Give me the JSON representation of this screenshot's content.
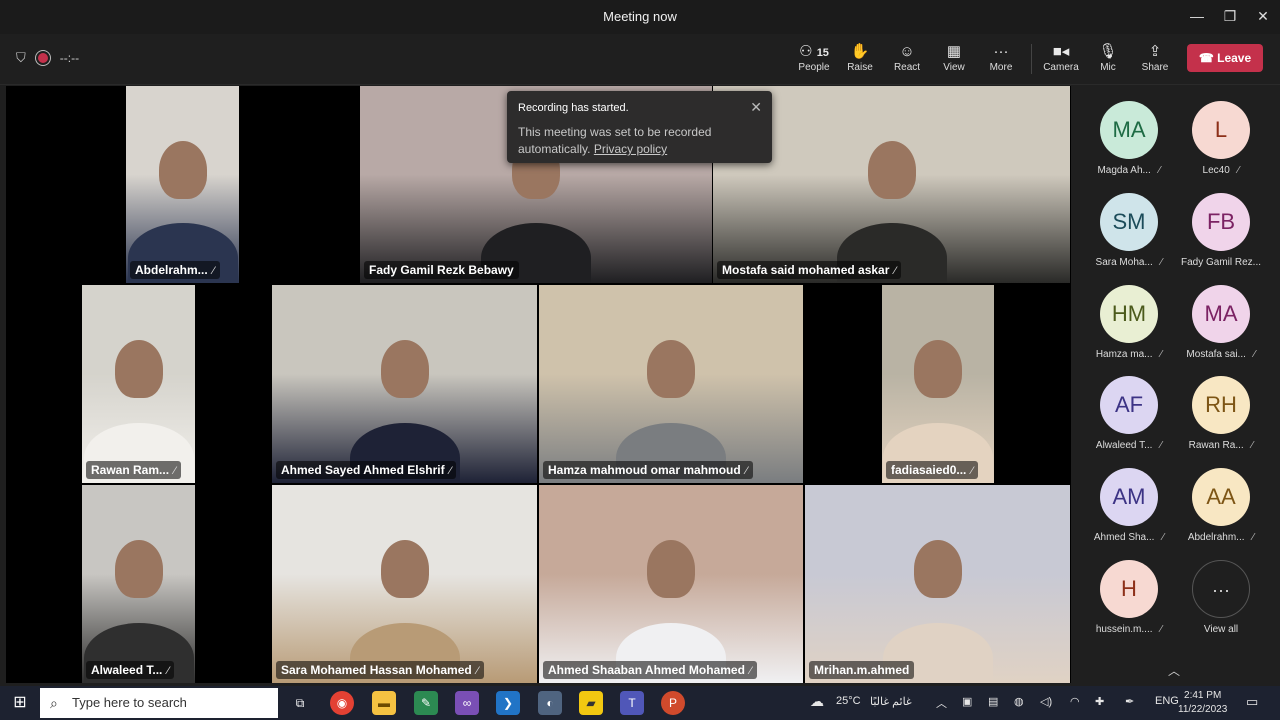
{
  "window": {
    "title": "Meeting now",
    "minimize": "—",
    "restore": "❐",
    "close": "✕"
  },
  "toolbar": {
    "timer": "--:--",
    "people_count": "15",
    "people": "People",
    "raise": "Raise",
    "react": "React",
    "view": "View",
    "more": "More",
    "camera": "Camera",
    "mic": "Mic",
    "share": "Share",
    "leave": "Leave"
  },
  "toast": {
    "title": "Recording has started.",
    "body": "This meeting was set to be recorded automatically.",
    "link": "Privacy policy"
  },
  "tiles": [
    {
      "name": "Abdelrahm...",
      "colors": [
        "#d8d4ce",
        "#2b3550"
      ]
    },
    {
      "name": "Fady Gamil Rezk Bebawy",
      "colors": [
        "#b8a9a6",
        "#1f1f22"
      ]
    },
    {
      "name": "Mostafa said mohamed askar",
      "colors": [
        "#cfc9bd",
        "#2a2a28"
      ]
    },
    {
      "name": "Rawan Ram...",
      "colors": [
        "#d5d3cc",
        "#f2f0ec"
      ]
    },
    {
      "name": "Ahmed Sayed Ahmed Elshrif",
      "colors": [
        "#c9c6be",
        "#1e2236"
      ]
    },
    {
      "name": "Hamza mahmoud omar mahmoud",
      "colors": [
        "#cfc2ab",
        "#7a7d80"
      ]
    },
    {
      "name": "fadiasaied0...",
      "colors": [
        "#b9b3a4",
        "#e4d3c0"
      ]
    },
    {
      "name": "Alwaleed T...",
      "colors": [
        "#c8c6c2",
        "#2f2f2f"
      ]
    },
    {
      "name": "Sara Mohamed Hassan Mohamed",
      "colors": [
        "#e6e4e0",
        "#b89b76"
      ]
    },
    {
      "name": "Ahmed Shaaban Ahmed Mohamed",
      "colors": [
        "#c6a999",
        "#f0f0f2"
      ]
    },
    {
      "name": "Mrihan.m.ahmed",
      "colors": [
        "#c8c9d4",
        "#e0d2c4"
      ]
    }
  ],
  "participants": [
    {
      "initials": "MA",
      "name": "Magda Ah...",
      "bg": "#c9ead9",
      "fg": "#1d6b44"
    },
    {
      "initials": "L",
      "name": "Lec40",
      "bg": "#f7d9d2",
      "fg": "#8d3019"
    },
    {
      "initials": "SM",
      "name": "Sara Moha...",
      "bg": "#cfe4ea",
      "fg": "#1c4c5a"
    },
    {
      "initials": "FB",
      "name": "Fady Gamil Rez...",
      "bg": "#f0d4ea",
      "fg": "#7b2263"
    },
    {
      "initials": "HM",
      "name": "Hamza ma...",
      "bg": "#e9efd3",
      "fg": "#4b5a1b"
    },
    {
      "initials": "MA",
      "name": "Mostafa sai...",
      "bg": "#f0d4ea",
      "fg": "#7b2263"
    },
    {
      "initials": "AF",
      "name": "Alwaleed T...",
      "bg": "#dcd6f2",
      "fg": "#3c3385"
    },
    {
      "initials": "RH",
      "name": "Rawan Ra...",
      "bg": "#f8e7c3",
      "fg": "#7d5515"
    },
    {
      "initials": "AM",
      "name": "Ahmed Sha...",
      "bg": "#dcd6f2",
      "fg": "#3c3385"
    },
    {
      "initials": "AA",
      "name": "Abdelrahm...",
      "bg": "#f8e7c3",
      "fg": "#7d5515"
    },
    {
      "initials": "H",
      "name": "hussein.m....",
      "bg": "#f7d9d2",
      "fg": "#8d3019"
    }
  ],
  "view_all": "View all",
  "taskbar": {
    "search_placeholder": "Type here to search",
    "weather": "25°C",
    "weather_text": "غائم غالبًا",
    "lang": "ENG",
    "time": "2:41 PM",
    "date": "11/22/2023"
  },
  "icons": {
    "mic_muted": "🎙",
    "mic_off_mark": "⁄"
  }
}
